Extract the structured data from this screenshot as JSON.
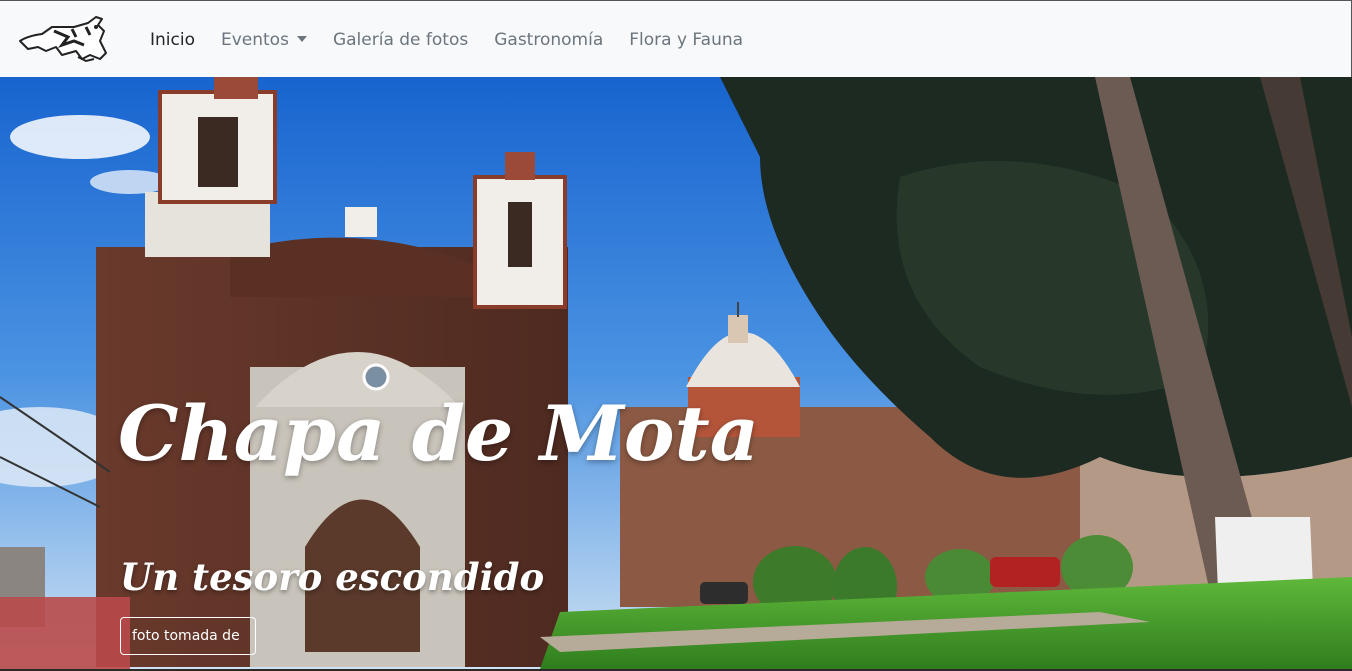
{
  "navbar": {
    "brand_icon": "cow-logo-icon",
    "items": [
      {
        "label": "Inicio",
        "active": true
      },
      {
        "label": "Eventos",
        "dropdown": true
      },
      {
        "label": "Galería de fotos"
      },
      {
        "label": "Gastronomía"
      },
      {
        "label": "Flora y Fauna"
      }
    ]
  },
  "hero": {
    "title": "Chapa de Mota",
    "subtitle": "Un tesoro escondido",
    "button_label": "foto tomada de"
  },
  "colors": {
    "navbar_bg": "#f8f9fa",
    "nav_active": "#212529",
    "nav_inactive": "#6c757d",
    "sky": "#2f7fd9"
  }
}
